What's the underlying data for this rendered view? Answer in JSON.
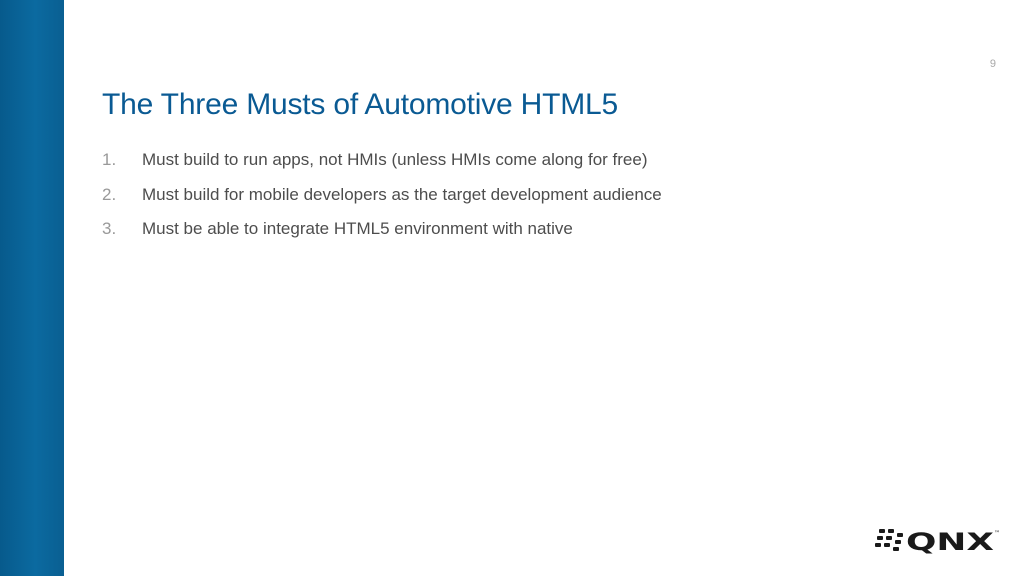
{
  "slide": {
    "page_number": "9",
    "title": "The Three Musts of Automotive HTML5",
    "items": [
      {
        "number": "1.",
        "text": "Must build to run apps, not HMIs (unless HMIs come along for free)"
      },
      {
        "number": "2.",
        "text": "Must build for mobile developers as the target development audience"
      },
      {
        "number": "3.",
        "text": "Must be able to integrate HTML5 environment with native"
      }
    ]
  },
  "logo": {
    "wordmark": "QNX",
    "trademark": "™"
  },
  "colors": {
    "sidebar": "#0b6aa0",
    "title": "#0a5a93",
    "body_text": "#4d4d4d",
    "number_text": "#999999"
  }
}
